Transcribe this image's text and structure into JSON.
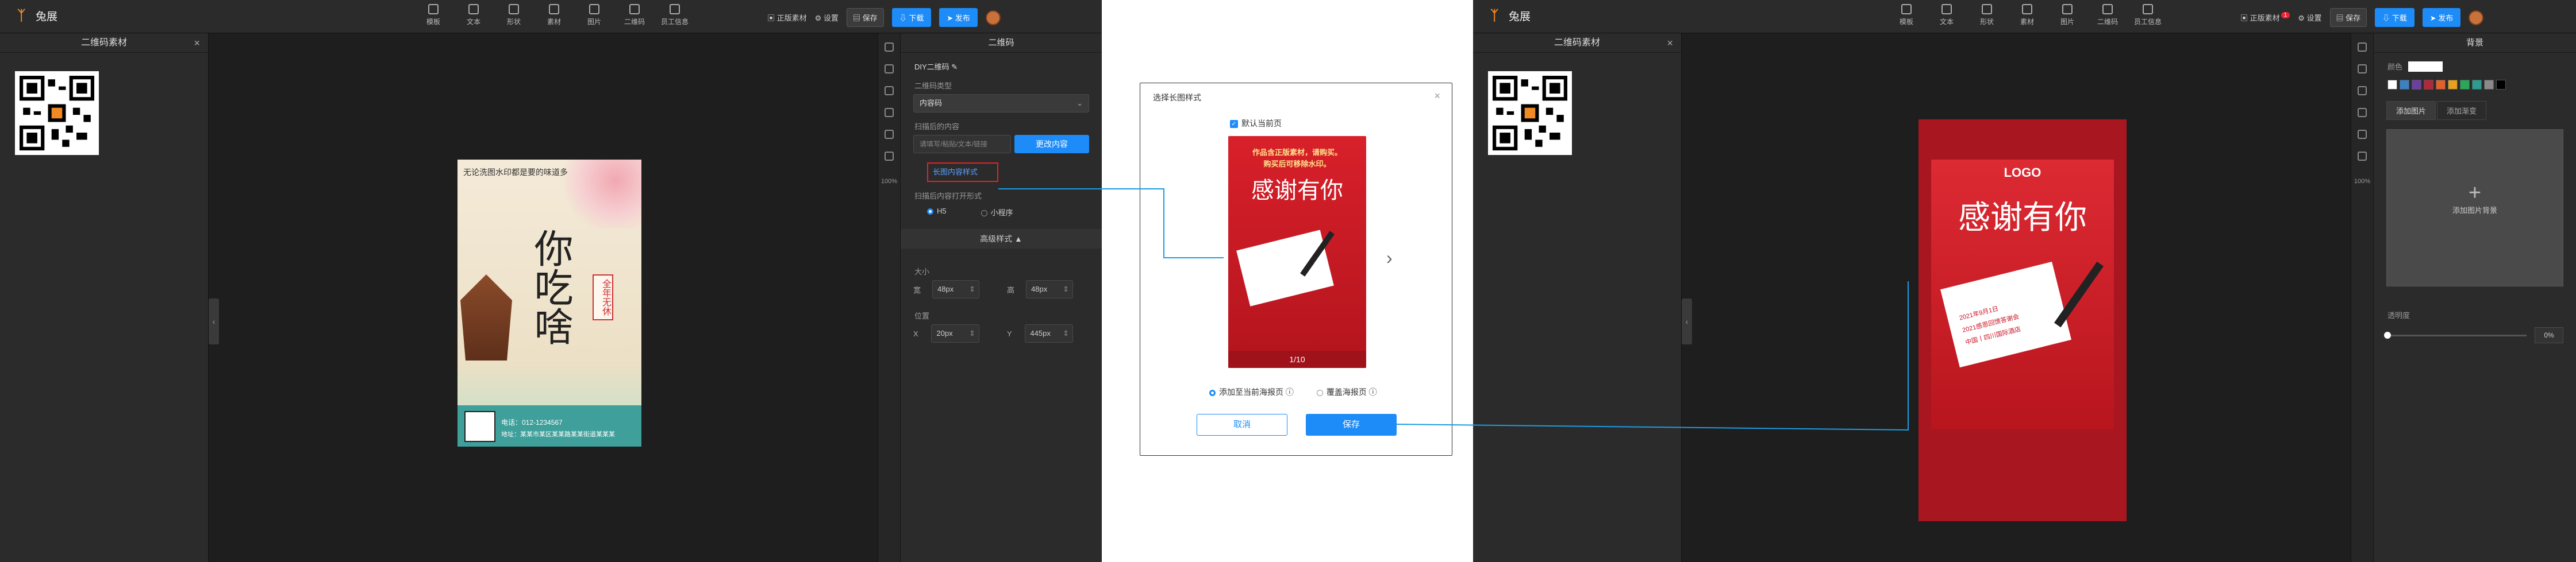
{
  "app": {
    "name": "兔展"
  },
  "toolbar": {
    "tools": [
      "模板",
      "文本",
      "形状",
      "素材",
      "图片",
      "二维码",
      "员工信息"
    ],
    "right_a": {
      "materials": "正版素材",
      "settings": "设置",
      "save": "保存",
      "download": "下载",
      "publish": "发布"
    },
    "right_b": {
      "materials": "正版素材",
      "materials_badge": "1",
      "settings": "设置",
      "save": "保存",
      "download": "下载",
      "publish": "发布"
    }
  },
  "left_panel": {
    "title": "二维码素材",
    "close": "×"
  },
  "collapse_glyph": "‹",
  "iconcol": {
    "zoom": "100%"
  },
  "qr_panel": {
    "title": "二维码",
    "name": "DIY二维码",
    "type_label": "二维码类型",
    "type_value": "内容码",
    "content_label": "扫描后的内容",
    "content_placeholder": "请填写/粘贴/文本/链接",
    "content_button": "更改内容",
    "link_style": "长图内容样式",
    "open_label": "扫描后内容打开形式",
    "open_h5": "H5",
    "open_mini": "小程序",
    "advanced": "高级样式 ▲",
    "size_label": "大小",
    "w_label": "宽",
    "w_value": "48px",
    "h_label": "高",
    "h_value": "48px",
    "pos_label": "位置",
    "x_label": "X",
    "x_value": "20px",
    "y_label": "Y",
    "y_value": "445px"
  },
  "poster_left": {
    "top_text": "无论洗图水印都是要的味道多",
    "vertical": "你吃啥",
    "badge": "全年无休",
    "phone": "电话：012-1234567",
    "address": "地址：某某市某区某某路某某街道某某某"
  },
  "dialog": {
    "title": "选择长图样式",
    "close": "×",
    "default_check": "默认当前页",
    "poster_line1": "作品含正版素材，请购买。",
    "poster_line2": "购买后可移除水印。",
    "big": "感谢有你",
    "counter": "1/10",
    "opt1": "添加至当前海报页",
    "opt2": "覆盖海报页",
    "cancel": "取消",
    "save": "保存",
    "next": "›"
  },
  "poster_right": {
    "logo": "LOGO",
    "big": "感谢有你",
    "card_line1": "2021年9月1日",
    "card_line2": "2021感恩回馈答谢会",
    "card_line3": "中国丨四川国际酒店"
  },
  "bg_panel": {
    "title": "背景",
    "color_label": "颜色",
    "tab_image": "添加图片",
    "tab_gradient": "添加渐变",
    "add_label": "添加图片背景",
    "opacity_label": "透明度",
    "opacity_value": "0%",
    "swatches": [
      "#ffffff",
      "#3b82c4",
      "#6d3fa0",
      "#b0283a",
      "#e0622a",
      "#e6a11f",
      "#2aa85a",
      "#2a9d8f",
      "#8a8a8a",
      "#000000"
    ]
  }
}
